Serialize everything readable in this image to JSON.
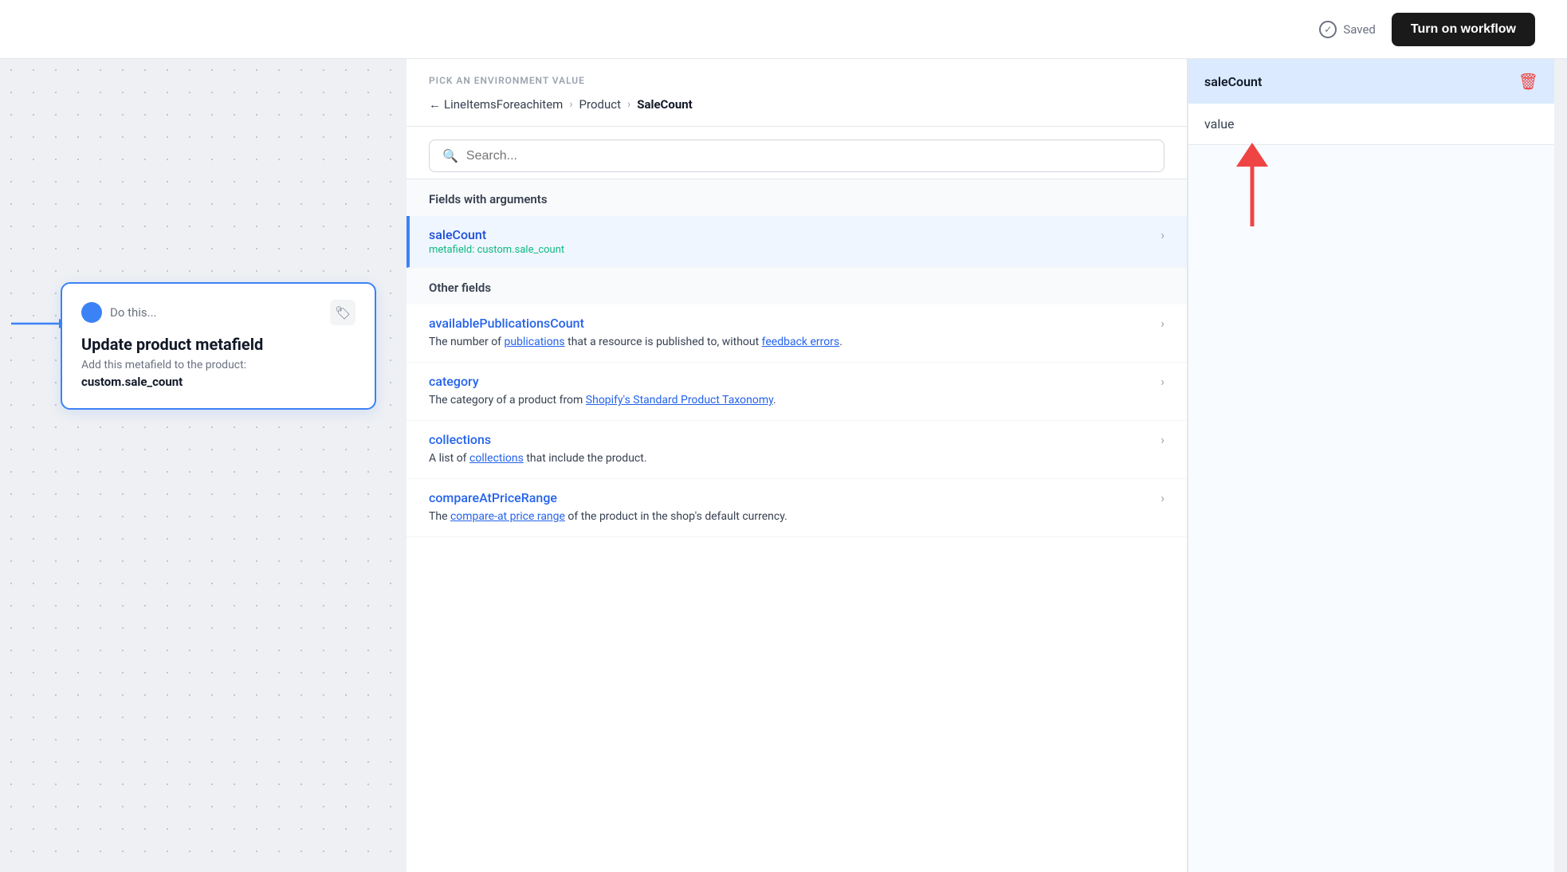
{
  "topbar": {
    "saved_label": "Saved",
    "turn_on_label": "Turn on workflow"
  },
  "card": {
    "do_this_label": "Do this...",
    "title": "Update product metafield",
    "description": "Add this metafield to the product:",
    "value": "custom.sale_count"
  },
  "panel": {
    "pick_label": "PICK AN ENVIRONMENT VALUE",
    "breadcrumb": {
      "back_label": "LineItemsForeachitem",
      "middle": "Product",
      "current": "SaleCount"
    },
    "search_placeholder": "Search...",
    "fields_with_args_label": "Fields with arguments",
    "selected_field": {
      "name": "saleCount",
      "sub": "metafield: custom.sale_count"
    },
    "other_fields_label": "Other fields",
    "fields": [
      {
        "name": "availablePublicationsCount",
        "desc_parts": [
          "The number of ",
          "publications",
          " that a resource is published to, without ",
          "feedback errors",
          "."
        ]
      },
      {
        "name": "category",
        "desc_parts": [
          "The category of a product from ",
          "Shopify's Standard Product Taxonomy",
          "."
        ]
      },
      {
        "name": "collections",
        "desc_parts": [
          "A list of ",
          "collections",
          " that include the product."
        ]
      },
      {
        "name": "compareAtPriceRange",
        "desc_parts": [
          "The ",
          "compare-at price range",
          " of the product in the shop's default currency."
        ]
      }
    ]
  },
  "right_panel": {
    "title": "saleCount",
    "value_label": "value"
  }
}
